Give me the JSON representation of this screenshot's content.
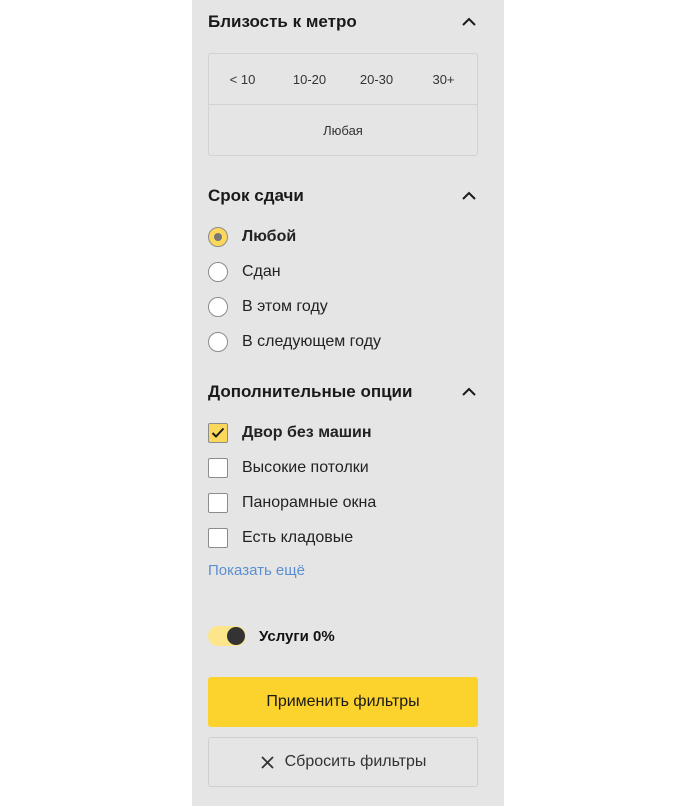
{
  "metro": {
    "title": "Близость к метро",
    "options": [
      "< 10",
      "10-20",
      "20-30",
      "30+"
    ],
    "any_label": "Любая"
  },
  "term": {
    "title": "Срок сдачи",
    "options": [
      {
        "label": "Любой",
        "checked": true
      },
      {
        "label": "Сдан",
        "checked": false
      },
      {
        "label": "В этом году",
        "checked": false
      },
      {
        "label": "В следующем году",
        "checked": false
      }
    ]
  },
  "extra": {
    "title": "Дополнительные опции",
    "options": [
      {
        "label": "Двор без машин",
        "checked": true
      },
      {
        "label": "Высокие потолки",
        "checked": false
      },
      {
        "label": "Панорамные окна",
        "checked": false
      },
      {
        "label": "Есть кладовые",
        "checked": false
      }
    ],
    "show_more": "Показать ещё"
  },
  "services": {
    "label": "Услуги 0%",
    "enabled": true
  },
  "buttons": {
    "apply": "Применить фильтры",
    "reset": "Сбросить фильтры"
  },
  "colors": {
    "panel_bg": "#e5e5e5",
    "accent": "#fcd22d",
    "link": "#5b8fd3"
  },
  "icons": {
    "collapse": "chevron-up-icon",
    "check": "check-icon",
    "reset": "close-icon"
  }
}
